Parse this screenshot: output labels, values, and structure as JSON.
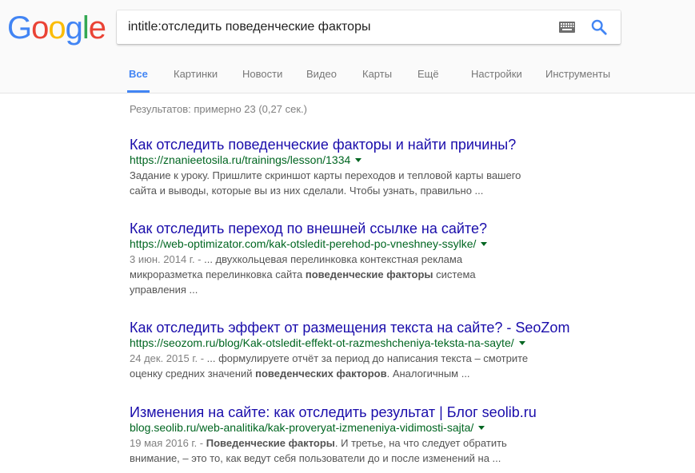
{
  "logo": {
    "letters": [
      "G",
      "o",
      "o",
      "g",
      "l",
      "e"
    ],
    "colors": [
      "#4285f4",
      "#ea4335",
      "#fbbc05",
      "#4285f4",
      "#34a853",
      "#ea4335"
    ]
  },
  "search": {
    "query": "intitle:отследить поведенческие факторы",
    "keyboard_icon": "keyboard-icon",
    "search_icon": "search-icon"
  },
  "tabs": [
    {
      "label": "Все",
      "active": true
    },
    {
      "label": "Картинки",
      "active": false
    },
    {
      "label": "Новости",
      "active": false
    },
    {
      "label": "Видео",
      "active": false
    },
    {
      "label": "Карты",
      "active": false
    },
    {
      "label": "Ещё",
      "active": false
    },
    {
      "label": "Настройки",
      "active": false
    },
    {
      "label": "Инструменты",
      "active": false
    }
  ],
  "result_stats": "Результатов: примерно 23 (0,27 сек.)",
  "results": [
    {
      "title": "Как отследить поведенческие факторы и найти причины?",
      "url": "https://znanieetosila.ru/trainings/lesson/1334",
      "snippet_line1": "Задание к уроку. Пришлите скриншот карты переходов и тепловой карты вашего",
      "snippet_line2": "сайта и выводы, которые вы из них сделали. Чтобы узнать, правильно ..."
    },
    {
      "title": "Как отследить переход по внешней ссылке на сайте?",
      "url": "https://web-optimizator.com/kak-otsledit-perehod-po-vneshney-ssylke/",
      "date": "3 июн. 2014 г. - ",
      "snippet_line1": "... двухкольцевая перелинковка контекстная реклама",
      "snippet_line2_pre": "микроразметка перелинковка сайта ",
      "snippet_line2_bold": "поведенческие факторы",
      "snippet_line2_post": " система",
      "snippet_line3": "управления ..."
    },
    {
      "title": "Как отследить эффект от размещения текста на сайте? - SeoZom",
      "url": "https://seozom.ru/blog/Kak-otsledit-effekt-ot-razmeshcheniya-teksta-na-sayte/",
      "date": "24 дек. 2015 г. - ",
      "snippet_line1": "... формулируете отчёт за период до написания текста – смотрите",
      "snippet_line2_pre": "оценку средних значений ",
      "snippet_line2_bold": "поведенческих факторов",
      "snippet_line2_post": ". Аналогичным ..."
    },
    {
      "title": "Изменения на сайте: как отследить результат | Блог seolib.ru",
      "url": "blog.seolib.ru/web-analitika/kak-proveryat-izmeneniya-vidimosti-sajta/",
      "date": "19 мая 2016 г. - ",
      "snippet_line1_bold": "Поведенческие факторы",
      "snippet_line1_post": ". И третье, на что следует обратить",
      "snippet_line2": "внимание, – это то, как ведут себя пользователи до и после изменений на ..."
    }
  ]
}
